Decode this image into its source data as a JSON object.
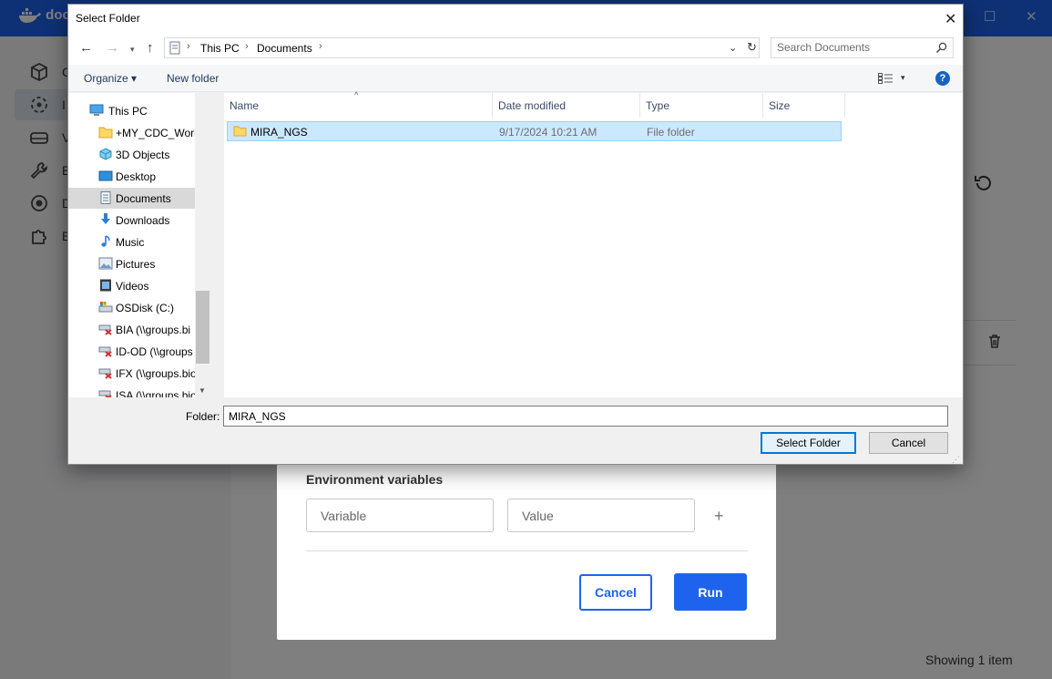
{
  "docker": {
    "logo_text": "doc",
    "brand_color": "#1d63ed",
    "sidebar": [
      {
        "label": "C",
        "icon": "box-icon"
      },
      {
        "label": "I",
        "icon": "images-icon"
      },
      {
        "label": "V",
        "icon": "volumes-icon"
      },
      {
        "label": "B",
        "icon": "builds-icon"
      },
      {
        "label": "D",
        "icon": "scout-icon"
      },
      {
        "label": "E",
        "icon": "extensions-icon"
      }
    ],
    "status_text": "Showing 1 item"
  },
  "run_modal": {
    "env_title": "Environment variables",
    "variable_placeholder": "Variable",
    "value_placeholder": "Value",
    "add_symbol": "+",
    "cancel_label": "Cancel",
    "run_label": "Run"
  },
  "dialog": {
    "title": "Select Folder",
    "close_symbol": "✕",
    "breadcrumb": [
      "This PC",
      "Documents"
    ],
    "search_placeholder": "Search Documents",
    "organize_label": "Organize ▾",
    "new_folder_label": "New folder",
    "help_symbol": "?",
    "nav_items": [
      {
        "label": "This PC",
        "icon": "computer-icon"
      },
      {
        "label": "+MY_CDC_Work",
        "icon": "folder-icon"
      },
      {
        "label": "3D Objects",
        "icon": "3d-objects-icon"
      },
      {
        "label": "Desktop",
        "icon": "desktop-icon"
      },
      {
        "label": "Documents",
        "icon": "documents-icon",
        "selected": true
      },
      {
        "label": "Downloads",
        "icon": "downloads-icon"
      },
      {
        "label": "Music",
        "icon": "music-icon"
      },
      {
        "label": "Pictures",
        "icon": "pictures-icon"
      },
      {
        "label": "Videos",
        "icon": "videos-icon"
      },
      {
        "label": "OSDisk (C:)",
        "icon": "disk-icon"
      },
      {
        "label": "BIA (\\\\groups.bi",
        "icon": "network-drive-icon"
      },
      {
        "label": "ID-OD (\\\\groups",
        "icon": "network-drive-icon"
      },
      {
        "label": "IFX (\\\\groups.bio",
        "icon": "network-drive-icon"
      },
      {
        "label": "ISA (\\\\groups.bio",
        "icon": "network-drive-icon"
      }
    ],
    "columns": [
      "Name",
      "Date modified",
      "Type",
      "Size"
    ],
    "files": [
      {
        "name": "MIRA_NGS",
        "date": "9/17/2024 10:21 AM",
        "type": "File folder",
        "size": ""
      }
    ],
    "folder_label": "Folder:",
    "folder_value": "MIRA_NGS",
    "select_label": "Select Folder",
    "cancel_label": "Cancel"
  }
}
